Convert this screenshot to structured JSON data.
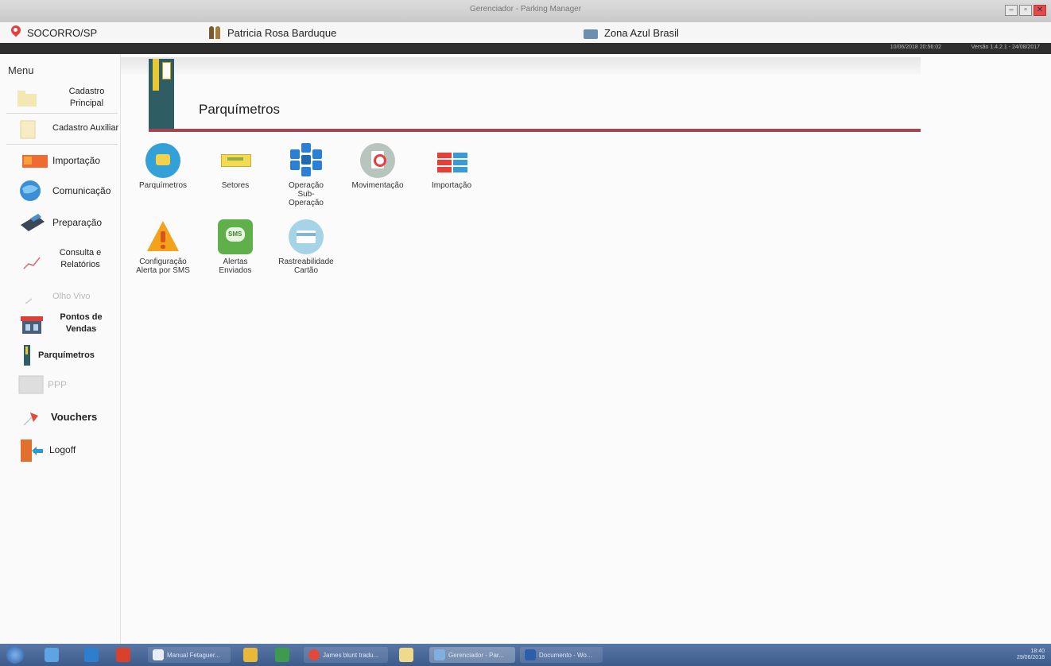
{
  "window": {
    "title": "Gerenciador - Parking Manager",
    "minimize": "–",
    "restore": "▫",
    "close": "✕"
  },
  "header": {
    "city": "SOCORRO/SP",
    "user": "Patricia Rosa Barduque",
    "company": "Zona Azul Brasil"
  },
  "strip": {
    "datetime": "10/06/2018 20:56:02",
    "version": "Versão 1.4.2.1 - 24/08/2017"
  },
  "sidebar": {
    "menu_title": "Menu",
    "items": [
      {
        "label": "Cadastro Principal",
        "icon": "folder-icon"
      },
      {
        "label": "Cadastro Auxiliar",
        "icon": "document-icon"
      },
      {
        "label": "Importação",
        "icon": "import-icon"
      },
      {
        "label": "Comunicação",
        "icon": "globe-icon"
      },
      {
        "label": "Preparação",
        "icon": "card-reader-icon"
      },
      {
        "label": "Consulta e Relatórios",
        "icon": "chart-icon"
      },
      {
        "label": "Olho Vivo",
        "icon": "eye-icon"
      },
      {
        "label": "Pontos de Vendas",
        "icon": "store-icon"
      },
      {
        "label": "Parquímetros",
        "icon": "parking-meter-icon"
      },
      {
        "label": "PPP",
        "icon": "ppp-icon"
      },
      {
        "label": "Vouchers",
        "icon": "voucher-icon"
      },
      {
        "label": "Logoff",
        "icon": "logoff-icon"
      }
    ]
  },
  "banner": {
    "title": "Parquímetros"
  },
  "grid": [
    {
      "label": "Parquímetros",
      "icon": "parking-meter-icon"
    },
    {
      "label": "Setores",
      "icon": "sector-icon"
    },
    {
      "label": "Operação Sub-Operação",
      "icon": "snowflake-icon"
    },
    {
      "label": "Movimentação",
      "icon": "movement-icon"
    },
    {
      "label": "Importação",
      "icon": "import-table-icon"
    },
    {
      "label": "Configuração Alerta por SMS",
      "icon": "warning-icon"
    },
    {
      "label": "Alertas Enviados",
      "icon": "sms-icon"
    },
    {
      "label": "Rastreabilidade Cartão",
      "icon": "card-icon"
    }
  ],
  "taskbar": {
    "apps": [
      "Manual Fetaguer...",
      "James blunt tradu...",
      "Gerenciador - Par...",
      "Documento - Wo..."
    ],
    "clock_time": "18:40",
    "clock_date": "29/06/2018"
  },
  "colors": {
    "accent_bar": "#a24653",
    "meter": "#2f5d63",
    "taskbar": "#4a6b9c"
  }
}
